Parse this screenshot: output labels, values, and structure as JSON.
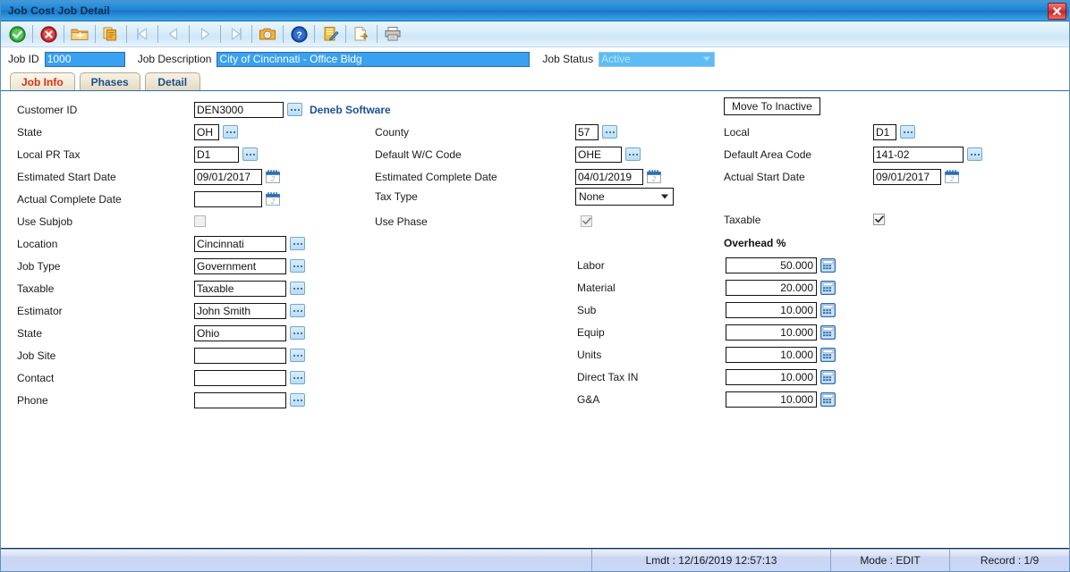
{
  "window": {
    "title": "Job Cost Job Detail",
    "close_icon": "close-icon"
  },
  "toolbar": {
    "buttons": [
      {
        "name": "ok-save-button",
        "icon": "green-check-circle-icon",
        "label": "OK"
      },
      {
        "name": "cancel-button",
        "icon": "red-x-circle-icon",
        "label": "Cancel"
      },
      {
        "name": "new-record-button",
        "icon": "new-folder-icon",
        "label": "New"
      },
      {
        "name": "copy-record-button",
        "icon": "copy-pages-icon",
        "label": "Copy"
      },
      {
        "name": "first-record-button",
        "icon": "first-arrow-icon",
        "label": "First"
      },
      {
        "name": "previous-record-button",
        "icon": "previous-arrow-icon",
        "label": "Previous"
      },
      {
        "name": "next-record-button",
        "icon": "next-arrow-icon",
        "label": "Next"
      },
      {
        "name": "last-record-button",
        "icon": "last-arrow-icon",
        "label": "Last"
      },
      {
        "name": "find-record-button",
        "icon": "camera-search-icon",
        "label": "Find"
      },
      {
        "name": "help-button",
        "icon": "question-help-icon",
        "label": "Help"
      },
      {
        "name": "notes-button",
        "icon": "notepad-pencil-icon",
        "label": "Notes"
      },
      {
        "name": "export-button",
        "icon": "export-page-icon",
        "label": "Export"
      },
      {
        "name": "print-button",
        "icon": "printer-icon",
        "label": "Print"
      }
    ]
  },
  "header": {
    "job_id_label": "Job ID",
    "job_id_value": "1000",
    "job_description_label": "Job Description",
    "job_description_value": "City of Cincinnati - Office Bldg",
    "job_status_label": "Job Status",
    "job_status_value": "Active"
  },
  "tabs": [
    {
      "label": "Job Info",
      "active": true
    },
    {
      "label": "Phases",
      "active": false
    },
    {
      "label": "Detail",
      "active": false
    }
  ],
  "form": {
    "left": {
      "customer_id_label": "Customer ID",
      "customer_id_value": "DEN3000",
      "customer_name": "Deneb Software",
      "state_label": "State",
      "state_value": "OH",
      "local_pr_tax_label": "Local PR Tax",
      "local_pr_tax_value": "D1",
      "estimated_start_date_label": "Estimated Start Date",
      "estimated_start_date_value": "09/01/2017",
      "actual_complete_date_label": "Actual Complete Date",
      "actual_complete_date_value": "",
      "use_subjob_label": "Use Subjob",
      "use_subjob_checked": false,
      "location_label": "Location",
      "location_value": "Cincinnati",
      "job_type_label": "Job Type",
      "job_type_value": "Government",
      "taxable_label": "Taxable",
      "taxable_value": "Taxable",
      "estimator_label": "Estimator",
      "estimator_value": "John Smith",
      "state2_label": "State",
      "state2_value": "Ohio",
      "job_site_label": "Job Site",
      "job_site_value": "",
      "contact_label": "Contact",
      "contact_value": "",
      "phone_label": "Phone",
      "phone_value": ""
    },
    "middle": {
      "county_label": "County",
      "county_value": "57",
      "default_wc_code_label": "Default W/C Code",
      "default_wc_code_value": "OHE",
      "estimated_complete_date_label": "Estimated Complete Date",
      "estimated_complete_date_value": "04/01/2019",
      "tax_type_label": "Tax Type",
      "tax_type_value": "None",
      "use_phase_label": "Use Phase",
      "use_phase_checked": true
    },
    "right": {
      "move_to_inactive_label": "Move To Inactive",
      "local_label": "Local",
      "local_value": "D1",
      "default_area_code_label": "Default Area Code",
      "default_area_code_value": "141-02",
      "actual_start_date_label": "Actual Start Date",
      "actual_start_date_value": "09/01/2017",
      "taxable_label": "Taxable",
      "taxable_checked": true
    },
    "overhead": {
      "header": "Overhead %",
      "rows": [
        {
          "label": "Labor",
          "value": "50.000"
        },
        {
          "label": "Material",
          "value": "20.000"
        },
        {
          "label": "Sub",
          "value": "10.000"
        },
        {
          "label": "Equip",
          "value": "10.000"
        },
        {
          "label": "Units",
          "value": "10.000"
        },
        {
          "label": "Direct Tax IN",
          "value": "10.000"
        },
        {
          "label": "G&A",
          "value": "10.000"
        }
      ]
    }
  },
  "statusbar": {
    "lmdt": "Lmdt : 12/16/2019 12:57:13",
    "mode": "Mode : EDIT",
    "record": "Record : 1/9"
  },
  "colors": {
    "title_blue": "#1f86d4",
    "accent_red": "#d83010",
    "tab_text_blue": "#1a4f86",
    "customer_link_blue": "#1a4f9c",
    "selected_field_blue": "#3aa0f0"
  }
}
